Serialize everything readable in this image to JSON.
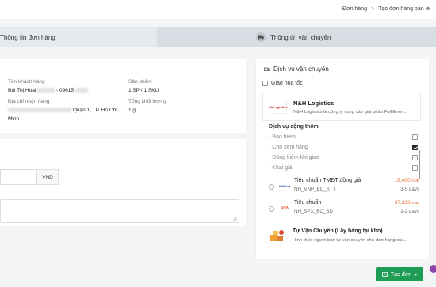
{
  "breadcrumb": {
    "item1": "Đơn hàng",
    "sep": ">",
    "item2": "Tạo đơn hàng bán lẻ"
  },
  "tabs": {
    "order_info": "Thông tin đơn hàng",
    "shipping_info": "Thông tin vận chuyển"
  },
  "customer": {
    "name_label": "Tên khách hàng",
    "name_value": "Bùi Thị Hoài",
    "phone_value": "- 09615",
    "address_label": "Địa chỉ nhận hàng",
    "address_value_1": "Quận 1, TP. Hồ Chí",
    "address_value_2": "Minh"
  },
  "product": {
    "label": "Sản phẩm",
    "value": "1 SP / 1 SKU",
    "weight_label": "Tổng khối lượng",
    "weight_value": "1 g"
  },
  "currency_label": "VND",
  "shipping": {
    "title": "Dịch vụ vận chuyển",
    "express_label": "Giao hỏa tốc",
    "provider_name": "N&H Logistics",
    "provider_logo": "NHLogistics",
    "provider_desc": "N&H Logistics là công ty cung cấp giải pháp Fulfillmen...",
    "addons_title": "Dịch vụ cộng thêm",
    "addons": [
      {
        "label": "- Bảo hiểm",
        "checked": false
      },
      {
        "label": "- Cho xem hàng",
        "checked": true
      },
      {
        "label": "- Đồng kiểm khi giao",
        "checked": false
      },
      {
        "label": "- Khai giá",
        "checked": false
      }
    ],
    "options": [
      {
        "name": "Tiêu chuẩn TMĐT đồng giá",
        "code": "NH_VNP_EC_STT",
        "price": "18,000",
        "unit": "VNĐ",
        "days": "3-5 days",
        "logo": "VNPost"
      },
      {
        "name": "Tiêu chuẩn",
        "code": "NH_SPX_EC_SD",
        "price": "37,333",
        "unit": "VNĐ",
        "days": "1-2 days",
        "logo": "SPX"
      }
    ],
    "self_ship_title": "Tự Vận Chuyển (Lấy hàng tại kho)",
    "self_ship_desc": "Hình thức người bán tự vận chuyển cho đơn hàng của..."
  },
  "create_button": "Tạo đơn"
}
